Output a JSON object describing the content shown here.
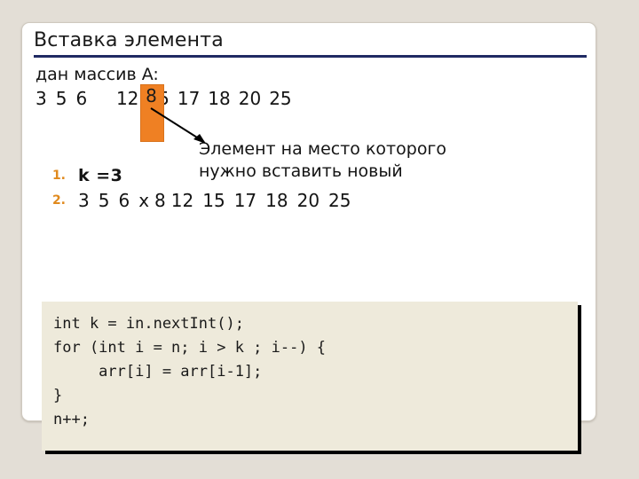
{
  "slide": {
    "title": "Вставка элемента",
    "lead": "дан массив A:",
    "array": {
      "values": [
        "3",
        "5",
        "6",
        "8",
        "12",
        "15",
        "17",
        "18",
        "20",
        "25"
      ],
      "highlight_index": 3,
      "highlight_value": "8",
      "highlight_color": "#ef8023"
    },
    "callout": "Элемент на место которого нужно вставить новый",
    "steps": [
      {
        "marker": "1.",
        "text": "k =3"
      },
      {
        "marker": "2.",
        "text": "3 5 6 x 8 12 15 17 18 20 25"
      }
    ],
    "step2_tokens": [
      "3",
      "5",
      "6",
      "x",
      "8",
      "12",
      "15",
      "17",
      "18",
      "20",
      "25"
    ],
    "code": "int k = in.nextInt();\nfor (int i = n; i > k ; i--) {\n     arr[i] = arr[i-1];\n}\nn++;",
    "colors": {
      "title_rule": "#202a63",
      "marker": "#e08a1e",
      "code_bg": "#eeeadb",
      "slide_bg": "#ffffff",
      "page_bg": "#e3ded6"
    }
  }
}
